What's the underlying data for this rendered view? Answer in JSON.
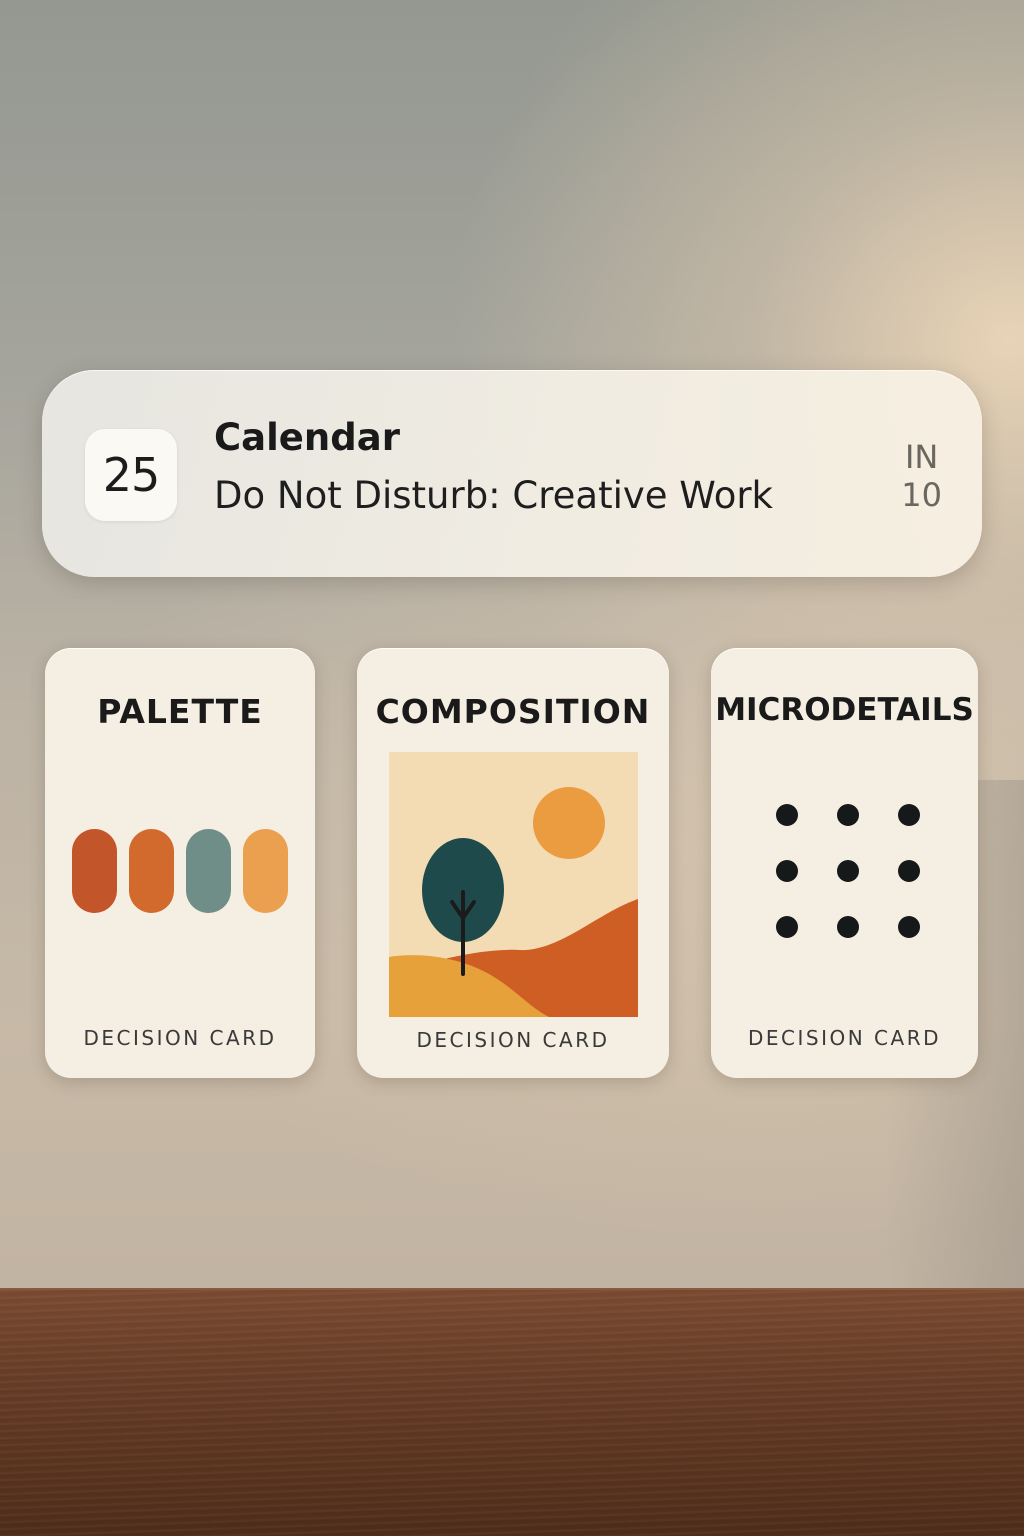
{
  "notification": {
    "icon": "calendar-icon",
    "day": "25",
    "app_name": "Calendar",
    "message": "Do Not Disturb: Creative Work",
    "time_line1": "IN",
    "time_line2": "10"
  },
  "cards": {
    "palette": {
      "title": "PALETTE",
      "footer": "DECISION CARD",
      "swatch_colors": [
        "#c2552a",
        "#d26a2e",
        "#6f8e87",
        "#eba04f"
      ]
    },
    "composition": {
      "title": "COMPOSITION",
      "footer": "DECISION CARD",
      "art_colors": {
        "sky": "#f3dcb4",
        "sun": "#eb9b40",
        "tree": "#1e4a4c",
        "trunk": "#1b1b1b",
        "hill_back": "#cf5e25",
        "hill_front": "#e7a13a"
      }
    },
    "microdetails": {
      "title": "MICRODETAILS",
      "footer": "DECISION CARD",
      "dot_grid": "3x3"
    }
  },
  "theme": {
    "card_background": "#f5eee2",
    "desk": "#6a3f28"
  }
}
